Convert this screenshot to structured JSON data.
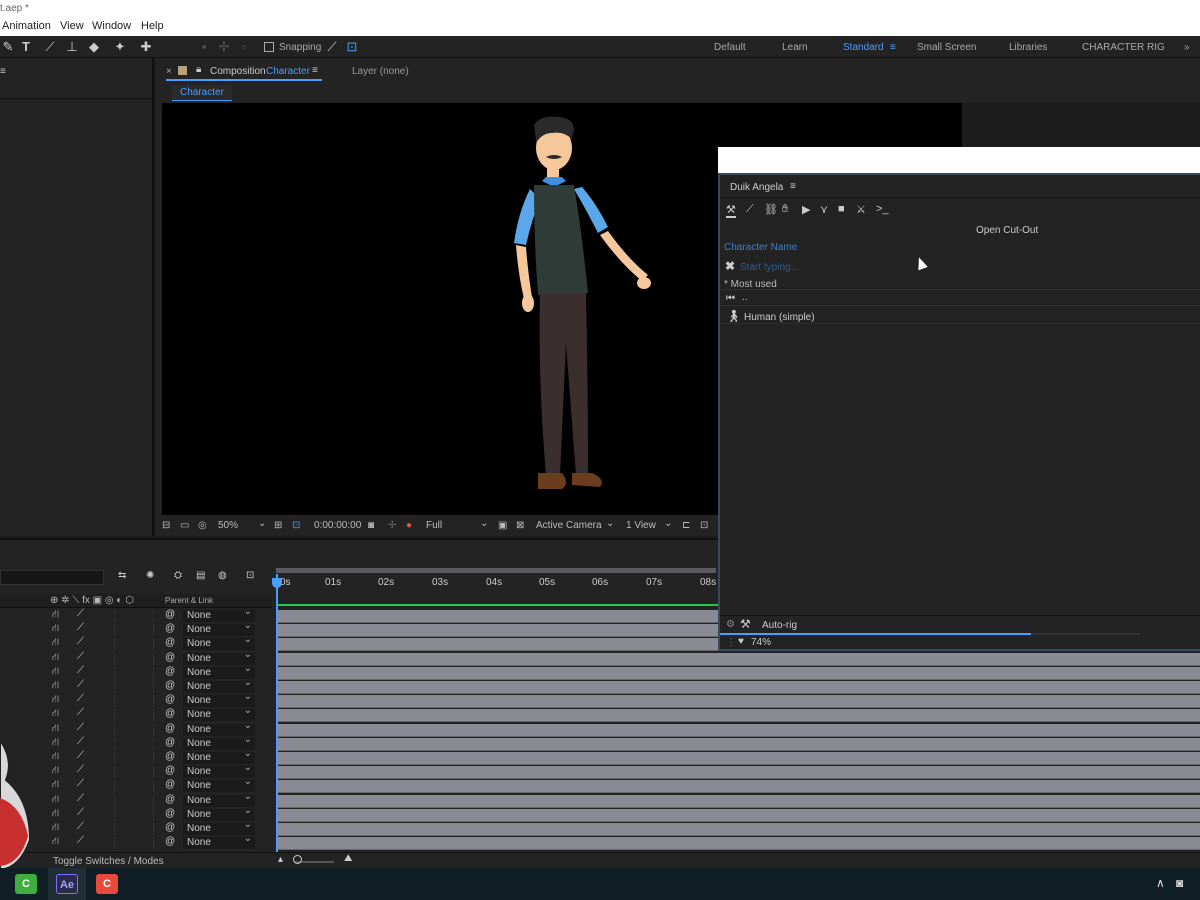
{
  "title": "t.aep *",
  "menu": [
    "Animation",
    "View",
    "Window",
    "Help"
  ],
  "toolbar": {
    "snapping_label": "Snapping",
    "workspaces": [
      "Default",
      "Learn",
      "Standard",
      "Small Screen",
      "Libraries",
      "CHARACTER RIG"
    ],
    "active_workspace": "Standard"
  },
  "comp": {
    "tab_prefix": "Composition",
    "tab_name": "Character",
    "layer_tab": "Layer (none)",
    "breadcrumb": "Character",
    "zoom": "50%",
    "timecode": "0:00:00:00",
    "resolution": "Full",
    "camera": "Active Camera",
    "views": "1 View"
  },
  "duik": {
    "title": "Duik Angela",
    "open_cutout": "Open Cut-Out",
    "character_name_label": "Character Name",
    "placeholder": "Start typing...",
    "most_used": "* Most used",
    "back_label": "..",
    "item": "Human (simple)",
    "autorig": "Auto-rig",
    "progress_label": "74%",
    "progress": 0.74
  },
  "timeline": {
    "ruler": [
      "0s",
      "01s",
      "02s",
      "03s",
      "04s",
      "05s",
      "06s",
      "07s",
      "08s"
    ],
    "parent_link_header": "Parent & Link",
    "parent_value": "None",
    "row_count": 17,
    "toggle_label": "Toggle Switches / Modes"
  },
  "colors": {
    "accent": "#4a9eff",
    "track": "#8a8a94",
    "work_area": "#23c84a"
  }
}
